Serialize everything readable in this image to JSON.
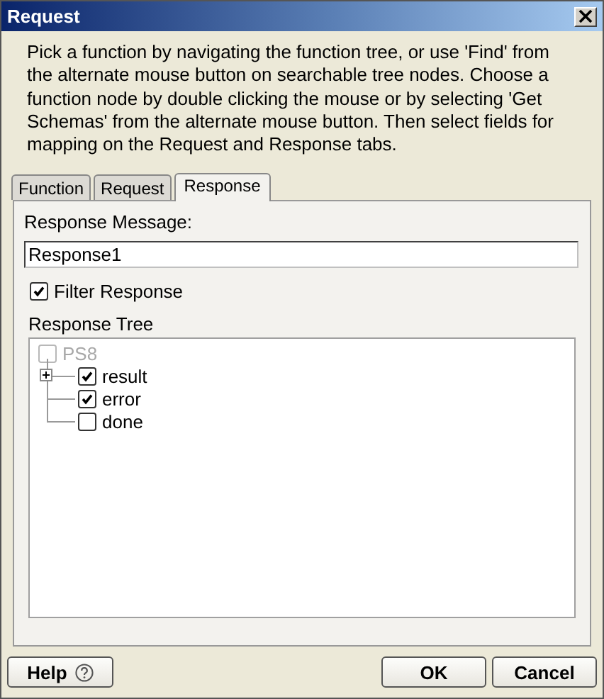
{
  "window": {
    "title": "Request"
  },
  "instructions": "Pick a function by navigating the function tree, or use 'Find' from the alternate mouse button on searchable tree nodes. Choose a function node by double clicking the mouse or by selecting 'Get Schemas' from the alternate mouse button. Then select fields for mapping on the Request and Response tabs.",
  "tabs": [
    {
      "label": "Function",
      "selected": false
    },
    {
      "label": "Request",
      "selected": false
    },
    {
      "label": "Response",
      "selected": true
    }
  ],
  "response_message": {
    "label": "Response Message:",
    "value": "Response1"
  },
  "filter_response": {
    "label": "Filter Response",
    "checked": true
  },
  "response_tree": {
    "label": "Response Tree",
    "root": {
      "label": "PS8",
      "checked": false,
      "disabled": true,
      "children": [
        {
          "label": "result",
          "checked": true,
          "disabled": false,
          "expanded": false,
          "kind": "branch"
        },
        {
          "label": "error",
          "checked": true,
          "disabled": false,
          "kind": "leaf"
        },
        {
          "label": "done",
          "checked": false,
          "disabled": false,
          "kind": "leaf"
        }
      ]
    }
  },
  "buttons": [
    {
      "label": "Help",
      "kind": "help"
    },
    {
      "label": "OK",
      "kind": "plain"
    },
    {
      "label": "Cancel",
      "kind": "plain"
    }
  ]
}
